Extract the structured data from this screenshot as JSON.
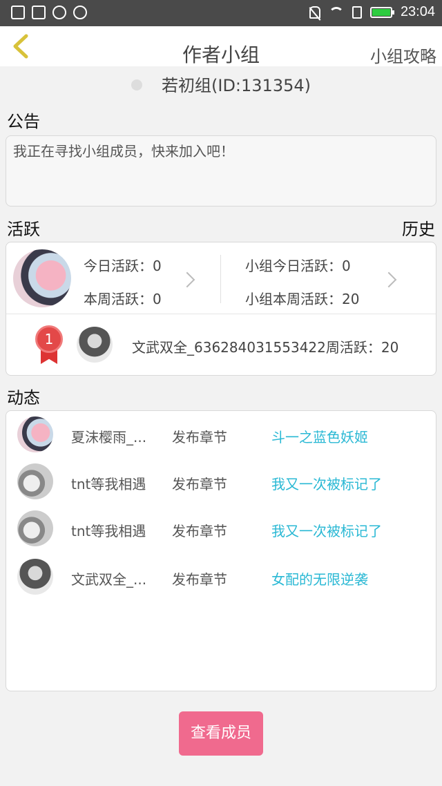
{
  "status_bar": {
    "time": "23:04"
  },
  "header": {
    "title": "作者小组",
    "guide_link": "小组攻略"
  },
  "group": {
    "name_id": "若初组(ID:131354)"
  },
  "notice": {
    "label": "公告",
    "text": "我正在寻找小组成员，快来加入吧！"
  },
  "active": {
    "label": "活跃",
    "history_link": "历史",
    "today_personal": "今日活跃：0",
    "week_personal": "本周活跃：0",
    "today_group": "小组今日活跃：0",
    "week_group": "小组本周活跃：20",
    "rank": "1",
    "top_member": "文武双全_636284031553422周活跃：20"
  },
  "feed": {
    "label": "动态",
    "items": [
      {
        "name": "夏沫樱雨_...",
        "action": "发布章节",
        "book": "斗一之蓝色妖姬"
      },
      {
        "name": "tnt等我相遇",
        "action": "发布章节",
        "book": "我又一次被标记了"
      },
      {
        "name": "tnt等我相遇",
        "action": "发布章节",
        "book": "我又一次被标记了"
      },
      {
        "name": "文武双全_...",
        "action": "发布章节",
        "book": "女配的无限逆袭"
      }
    ]
  },
  "members_button": "查看成员"
}
